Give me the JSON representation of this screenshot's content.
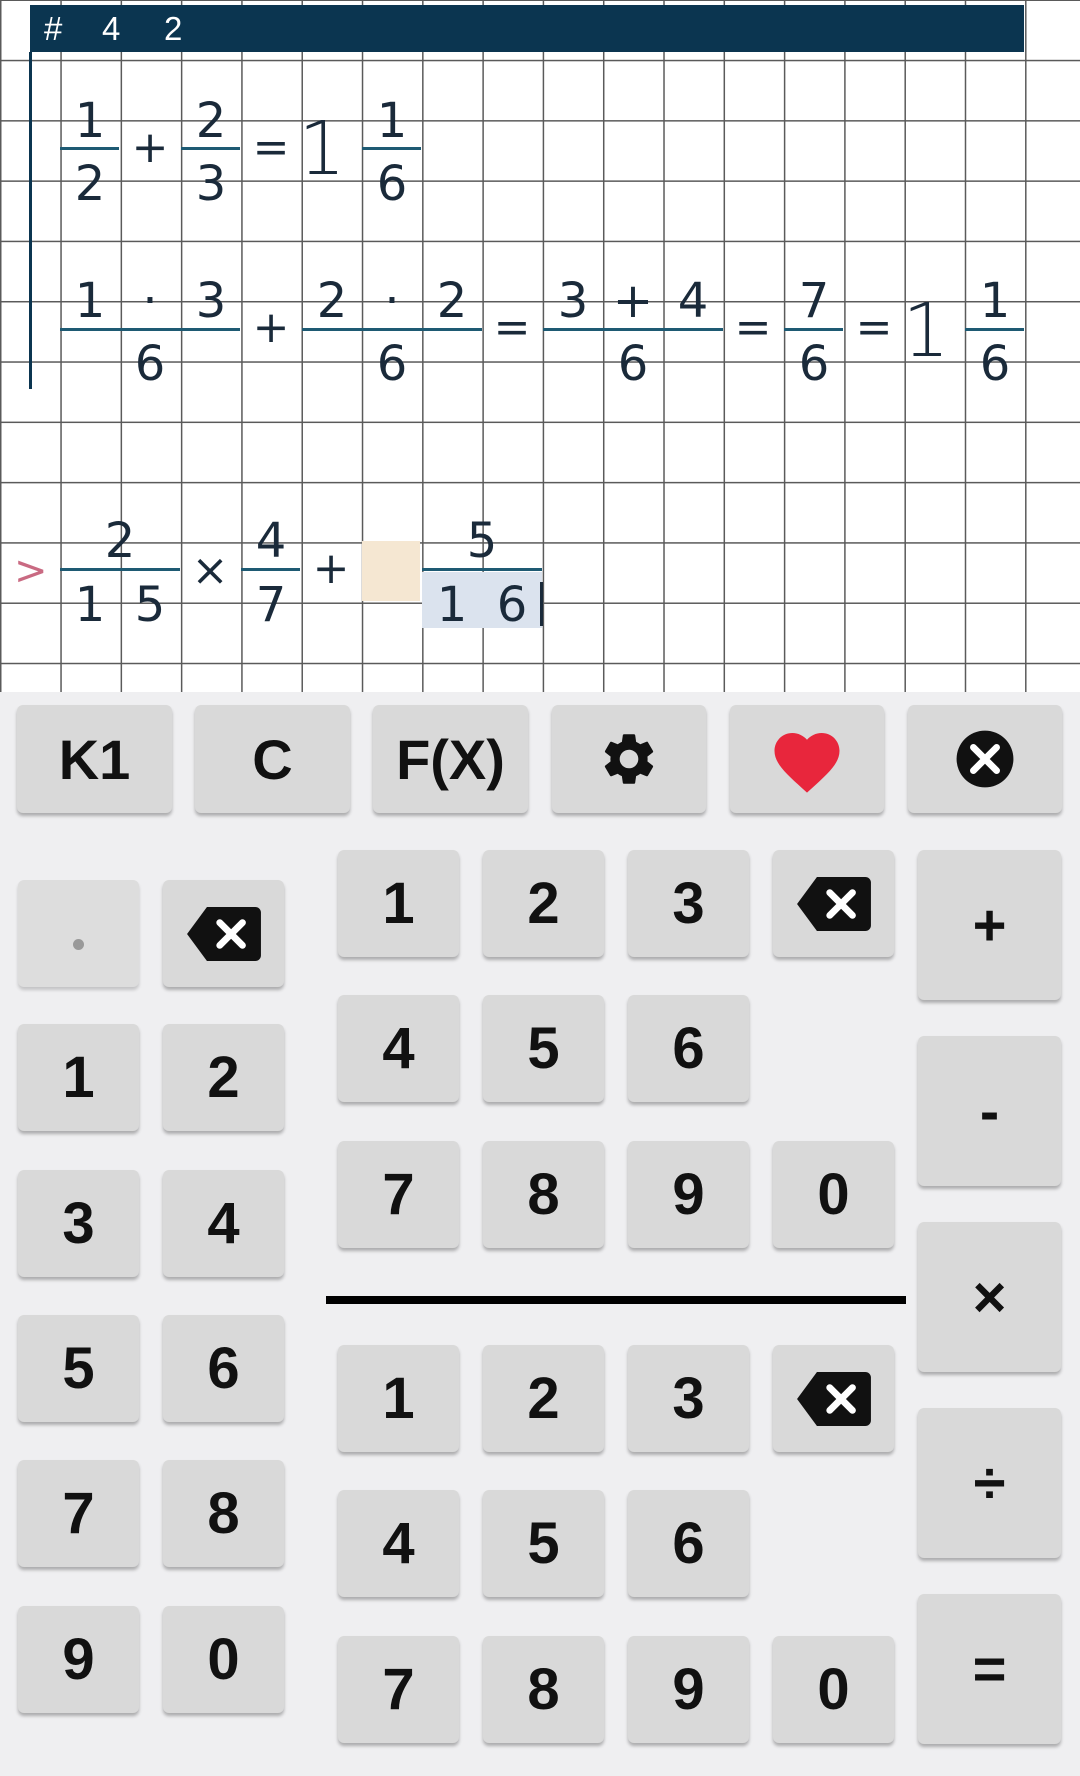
{
  "header": {
    "hash": "#",
    "num1": "4",
    "num2": "2"
  },
  "expr1": {
    "n1": "1",
    "d1": "2",
    "plus": "+",
    "n2": "2",
    "d2": "3",
    "eq": "=",
    "whole": "1",
    "rn": "1",
    "rd": "6"
  },
  "expr2": {
    "a1": "1",
    "dot1": "·",
    "a2": "3",
    "ad": "6",
    "plus": "+",
    "b1": "2",
    "dot2": "·",
    "b2": "2",
    "bd": "6",
    "eq1": "=",
    "c1": "3",
    "cplus": "+",
    "c2": "4",
    "cd": "6",
    "eq2": "=",
    "e1": "7",
    "ed": "6",
    "eq3": "=",
    "whole": "1",
    "rn": "1",
    "rd": "6"
  },
  "input": {
    "prompt": ">",
    "n1": "2",
    "d1a": "1",
    "d1b": "5",
    "times": "×",
    "n2": "4",
    "d2": "7",
    "plus": "+",
    "n3": "5",
    "d3a": "1",
    "d3b": "6"
  },
  "toolbar": {
    "k1": "K1",
    "c": "C",
    "fx": "F(X)",
    "settings_icon": "gear-icon",
    "favorite_icon": "heart-icon",
    "close_icon": "close-circle-icon"
  },
  "left_keys": {
    "dot": ".",
    "digits": [
      "1",
      "2",
      "3",
      "4",
      "5",
      "6",
      "7",
      "8",
      "9",
      "0"
    ]
  },
  "numerator_keys": [
    "1",
    "2",
    "3",
    "4",
    "5",
    "6",
    "7",
    "8",
    "9",
    "0"
  ],
  "denominator_keys": [
    "1",
    "2",
    "3",
    "4",
    "5",
    "6",
    "7",
    "8",
    "9",
    "0"
  ],
  "operators": {
    "plus": "+",
    "minus": "-",
    "times": "×",
    "divide": "÷",
    "equals": "="
  },
  "colors": {
    "header": "#0b3550",
    "heart": "#e8263c",
    "prompt": "#c96a82",
    "highlight_blue": "#dbe3ee",
    "highlight_tan": "#f5e7d2"
  }
}
